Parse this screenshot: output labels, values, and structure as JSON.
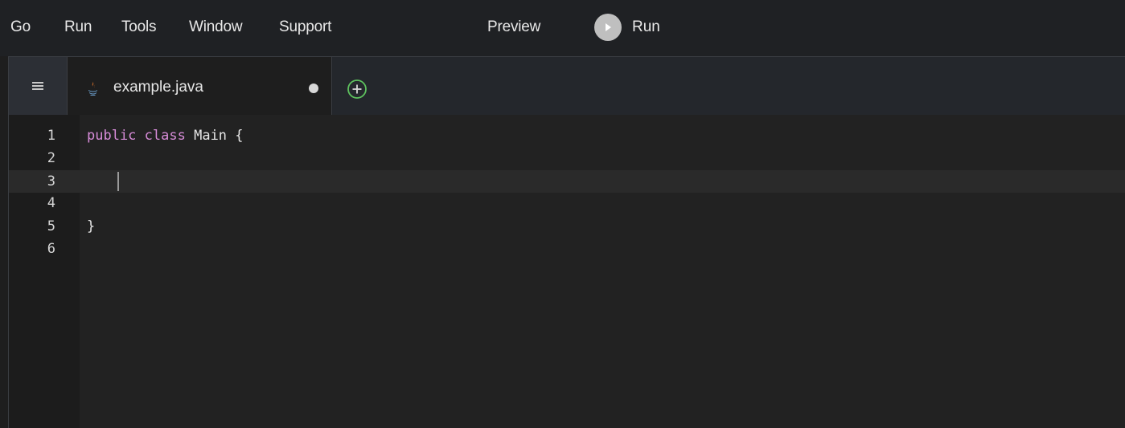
{
  "menu": {
    "items": [
      "Go",
      "Run",
      "Tools",
      "Window",
      "Support"
    ],
    "preview_label": "Preview",
    "run_label": "Run"
  },
  "tabs": {
    "active": {
      "label": "example.java",
      "file_icon": "java-icon",
      "unsaved": true
    },
    "add_icon": "plus-circle-icon",
    "menu_icon": "hamburger-icon"
  },
  "editor": {
    "line_numbers": [
      "1",
      "2",
      "3",
      "4",
      "5",
      "6"
    ],
    "active_line": 3,
    "lines": [
      {
        "keyword1": "public",
        "keyword2": "class",
        "rest": " Main {"
      },
      {
        "text": ""
      },
      {
        "text": ""
      },
      {
        "text": ""
      },
      {
        "text": "}"
      },
      {
        "text": ""
      }
    ]
  },
  "colors": {
    "keyword": "#d78cd8",
    "accent_add": "#5ec25e",
    "background": "#1e1e1e"
  }
}
